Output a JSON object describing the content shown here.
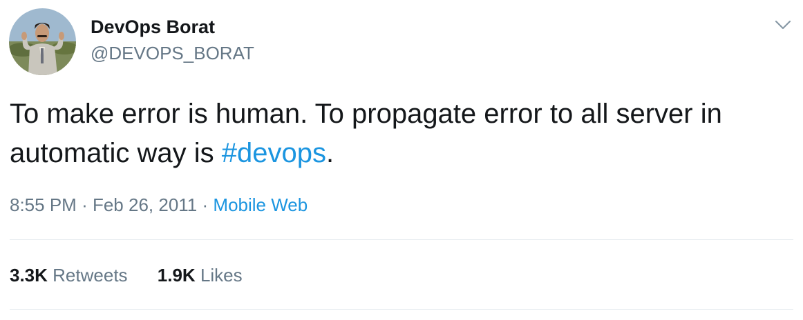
{
  "author": {
    "name": "DevOps Borat",
    "handle": "@DEVOPS_BORAT",
    "avatar_icon": "profile-photo"
  },
  "menu_icon": "chevron-down-icon",
  "tweet": {
    "text_before": "To make error is human. To propagate error to all server in automatic way is ",
    "hashtag": "#devops",
    "text_after": "."
  },
  "meta": {
    "time": "8:55 PM",
    "separator": "·",
    "date": "Feb 26, 2011",
    "source": "Mobile Web"
  },
  "stats": {
    "retweets_count": "3.3K",
    "retweets_label": "Retweets",
    "likes_count": "1.9K",
    "likes_label": "Likes"
  },
  "colors": {
    "text": "#14171a",
    "secondary": "#657786",
    "link": "#1b95e0",
    "divider": "#e6ecf0"
  }
}
